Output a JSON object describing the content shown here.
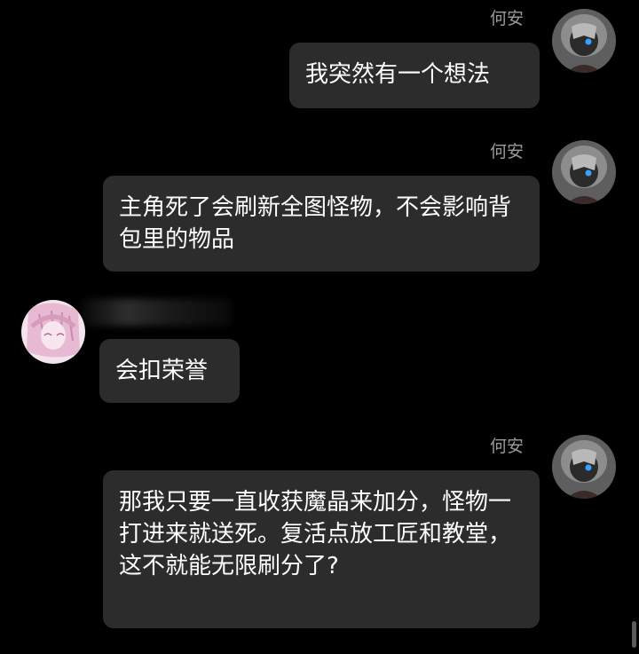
{
  "messages": [
    {
      "sender": "何安",
      "side": "right",
      "text": "我突然有一个想法"
    },
    {
      "sender": "何安",
      "side": "right",
      "text": "主角死了会刷新全图怪物，不会影响背包里的物品"
    },
    {
      "sender": "",
      "side": "left",
      "text": "会扣荣誉"
    },
    {
      "sender": "何安",
      "side": "right",
      "text": "那我只要一直收获魔晶来加分，怪物一打进来就送死。复活点放工匠和教堂，这不就能无限刷分了?"
    }
  ],
  "colors": {
    "background": "#000000",
    "bubble": "#2c2c2c",
    "bubble_text": "#ffffff",
    "sender_name": "#9a9a9a"
  },
  "icons": {
    "right_avatar": "grey-hooded-character-avatar",
    "left_avatar": "pink-anime-girl-avatar"
  }
}
